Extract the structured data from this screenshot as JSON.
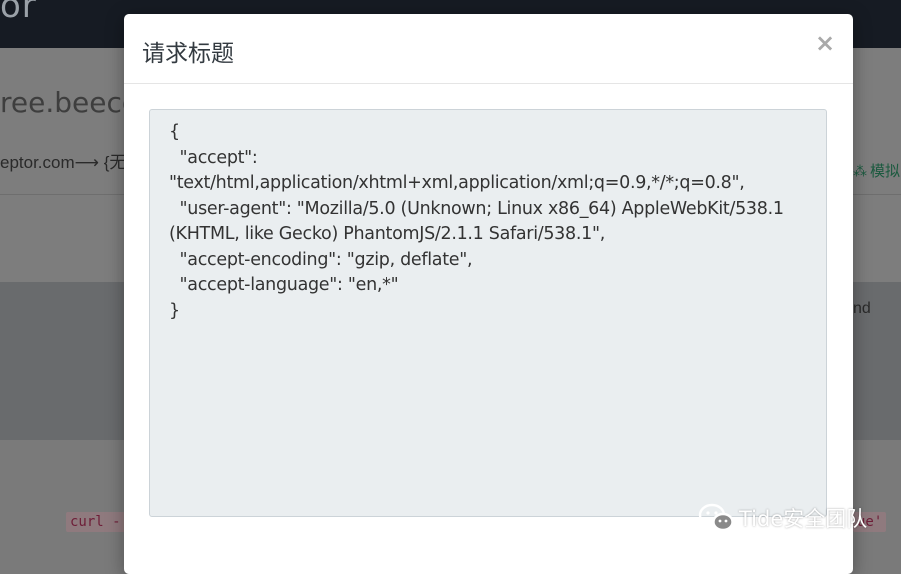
{
  "background": {
    "brand_fragment": "or",
    "domain_fragment": "ree.beece",
    "route_fragment": "eptor.com⟶ {无",
    "right_link_fragment": "模拟",
    "right_text_fragment": "nd",
    "curl_left_fragment": "curl -",
    "curl_right_fragment": "ue'"
  },
  "modal": {
    "title": "请求标题",
    "close_label": "×",
    "headers_json": "{\n  \"accept\": \"text/html,application/xhtml+xml,application/xml;q=0.9,*/*;q=0.8\",\n  \"user-agent\": \"Mozilla/5.0 (Unknown; Linux x86_64) AppleWebKit/538.1 (KHTML, like Gecko) PhantomJS/2.1.1 Safari/538.1\",\n  \"accept-encoding\": \"gzip, deflate\",\n  \"accept-language\": \"en,*\"\n}"
  },
  "watermark": {
    "text": "Tide安全团队",
    "icon": "wechat-icon"
  }
}
